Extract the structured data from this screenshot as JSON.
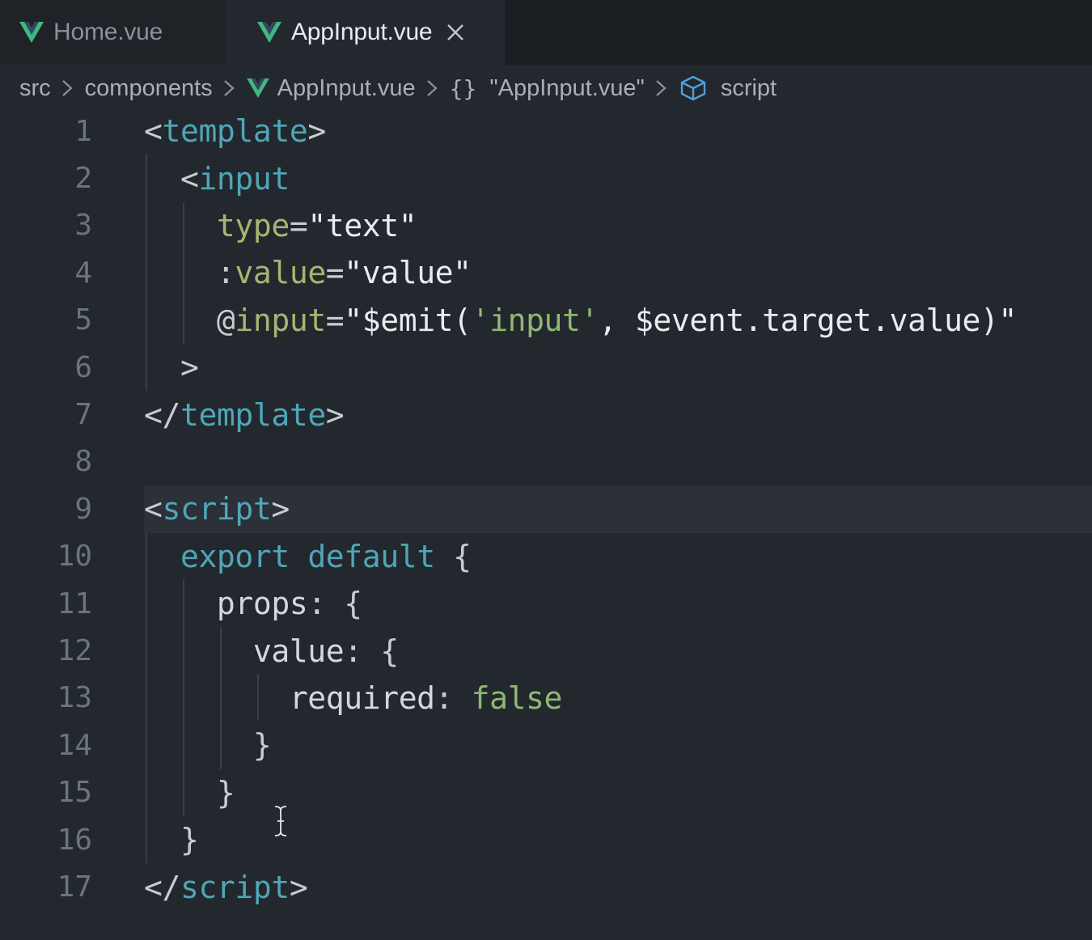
{
  "tabs": [
    {
      "label": "Home.vue",
      "active": false
    },
    {
      "label": "AppInput.vue",
      "active": true
    }
  ],
  "breadcrumb": {
    "folder1": "src",
    "folder2": "components",
    "file": "AppInput.vue",
    "braces": "{}",
    "object": "\"AppInput.vue\"",
    "section": "script"
  },
  "icons": {
    "vue": "vue-logo-icon",
    "close": "close-icon",
    "separator": "chevron-right-icon",
    "symbol": "cube-icon",
    "cursor": "text-cursor-icon"
  },
  "colors": {
    "vue_green": "#41b883",
    "vue_dark": "#35495e",
    "tag": "#4fa6b6",
    "attr": "#a7b572",
    "bool": "#8fb872",
    "background": "#23272e"
  },
  "editor": {
    "current_line": 9,
    "lines": [
      {
        "n": "1"
      },
      {
        "n": "2"
      },
      {
        "n": "3"
      },
      {
        "n": "4"
      },
      {
        "n": "5"
      },
      {
        "n": "6"
      },
      {
        "n": "7"
      },
      {
        "n": "8"
      },
      {
        "n": "9"
      },
      {
        "n": "10"
      },
      {
        "n": "11"
      },
      {
        "n": "12"
      },
      {
        "n": "13"
      },
      {
        "n": "14"
      },
      {
        "n": "15"
      },
      {
        "n": "16"
      },
      {
        "n": "17"
      }
    ],
    "tokens": {
      "l1": [
        "<",
        "template",
        ">"
      ],
      "l2": [
        "<",
        "input"
      ],
      "l3": [
        "type",
        "=",
        "\"text\""
      ],
      "l4": [
        ":",
        "value",
        "=",
        "\"value\""
      ],
      "l5": [
        "@",
        "input",
        "=",
        "\"$emit(",
        "'input'",
        ", $event.target.value)\""
      ],
      "l6": [
        ">"
      ],
      "l7": [
        "</",
        "template",
        ">"
      ],
      "l9": [
        "<",
        "script",
        ">"
      ],
      "l10": [
        "export",
        "default",
        "{"
      ],
      "l11": [
        "props",
        ": {"
      ],
      "l12": [
        "value",
        ": {"
      ],
      "l13": [
        "required",
        ": ",
        "false"
      ],
      "l14": [
        "}"
      ],
      "l15": [
        "}"
      ],
      "l16": [
        "}"
      ],
      "l17": [
        "</",
        "script",
        ">"
      ]
    }
  }
}
